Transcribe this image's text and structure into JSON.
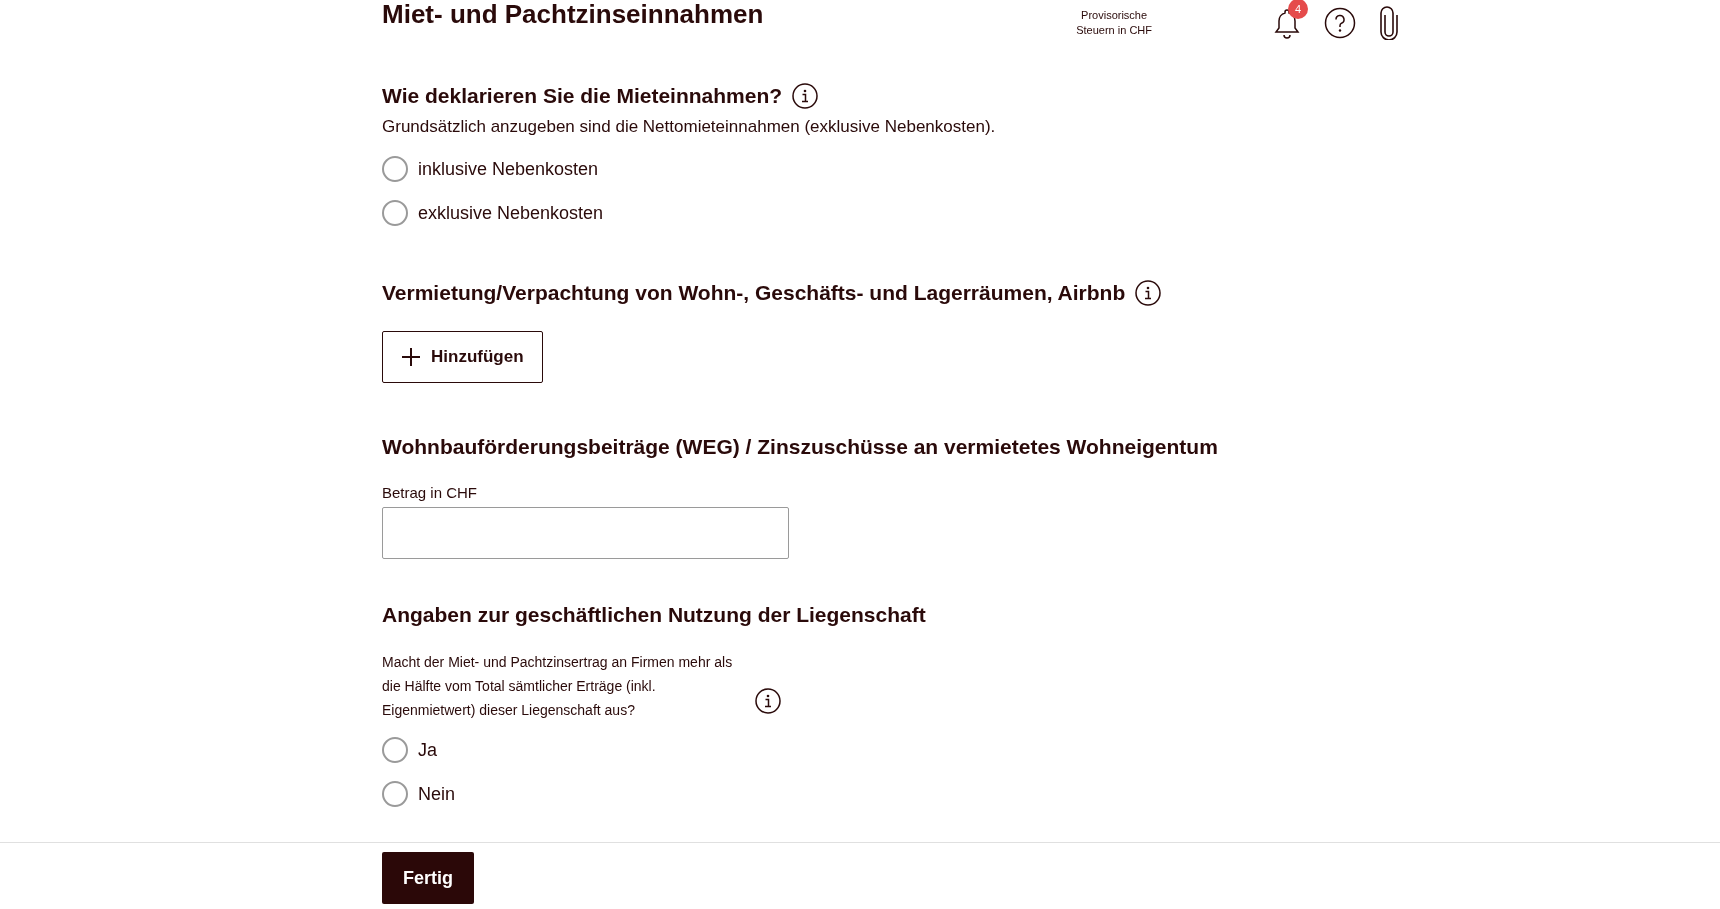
{
  "header": {
    "title": "Miet- und Pachtzinseinnahmen",
    "tax_info_lines": [
      "Provisorische",
      "Steuern in CHF"
    ],
    "notification_count": "4"
  },
  "sections": [
    {
      "kind": "radio",
      "heading": "Wie deklarieren Sie die Mieteinnahmen?",
      "info": true,
      "description": "Grundsätzlich anzugeben sind die Nettomieteinnahmen (exklusive Nebenkosten).",
      "options": [
        {
          "label": "inklusive Nebenkosten",
          "selected": false
        },
        {
          "label": "exklusive Nebenkosten",
          "selected": false
        }
      ]
    },
    {
      "kind": "add",
      "heading": "Vermietung/Verpachtung von Wohn-, Geschäfts- und Lagerräumen, Airbnb",
      "info": true,
      "button": "Hinzufügen"
    },
    {
      "kind": "amount",
      "heading": "Wohnbauförderungsbeiträge (WEG) / Zinszuschüsse an vermietetes Wohneigentum",
      "info": false,
      "field_label": "Betrag in CHF"
    },
    {
      "kind": "question",
      "heading": "Angaben zur geschäftlichen Nutzung der Liegenschaft",
      "info": true,
      "question": "Macht der Miet- und Pachtzinsertrag an Firmen mehr als die Hälfte vom Total sämtlicher Erträge (inkl. Eigenmietwert) dieser Liegenschaft aus?",
      "options": [
        {
          "label": "Ja",
          "selected": false
        },
        {
          "label": "Nein",
          "selected": false
        }
      ]
    }
  ],
  "footer": {
    "button": "Fertig"
  }
}
